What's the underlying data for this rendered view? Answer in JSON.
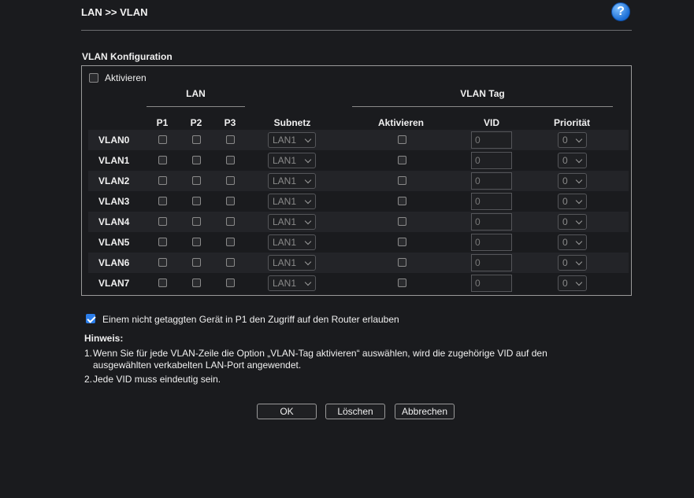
{
  "header": {
    "breadcrumb": "LAN >> VLAN",
    "help": "?"
  },
  "section_title": "VLAN Konfiguration",
  "panel": {
    "enable_label": "Aktivieren",
    "enable_checked": false,
    "group_lan": "LAN",
    "group_vlan_tag": "VLAN Tag",
    "columns": {
      "p1": "P1",
      "p2": "P2",
      "p3": "P3",
      "subnet": "Subnetz",
      "tag_enable": "Aktivieren",
      "vid": "VID",
      "priority": "Priorität"
    },
    "rows": [
      {
        "label": "VLAN0",
        "subnet": "LAN1",
        "vid": "0",
        "priority": "0"
      },
      {
        "label": "VLAN1",
        "subnet": "LAN1",
        "vid": "0",
        "priority": "0"
      },
      {
        "label": "VLAN2",
        "subnet": "LAN1",
        "vid": "0",
        "priority": "0"
      },
      {
        "label": "VLAN3",
        "subnet": "LAN1",
        "vid": "0",
        "priority": "0"
      },
      {
        "label": "VLAN4",
        "subnet": "LAN1",
        "vid": "0",
        "priority": "0"
      },
      {
        "label": "VLAN5",
        "subnet": "LAN1",
        "vid": "0",
        "priority": "0"
      },
      {
        "label": "VLAN6",
        "subnet": "LAN1",
        "vid": "0",
        "priority": "0"
      },
      {
        "label": "VLAN7",
        "subnet": "LAN1",
        "vid": "0",
        "priority": "0"
      }
    ]
  },
  "p1_access": {
    "label": "Einem nicht getaggten Gerät in P1 den Zugriff auf den Router erlauben",
    "checked": true
  },
  "notes": {
    "title": "Hinweis:",
    "n1_num": "1.",
    "n1_line1": "Wenn Sie für jede VLAN-Zeile die Option „VLAN-Tag aktivieren“ auswählen, wird die zugehörige VID auf den",
    "n1_line2": "ausgewählten verkabelten LAN-Port angewendet.",
    "n2_num": "2.",
    "n2_text": "Jede VID muss eindeutig sein."
  },
  "buttons": {
    "ok": "OK",
    "clear": "Löschen",
    "cancel": "Abbrechen"
  },
  "colors": {
    "background": "#1a1b1e",
    "accent": "#2b7de9",
    "row_shade": "#232428"
  }
}
